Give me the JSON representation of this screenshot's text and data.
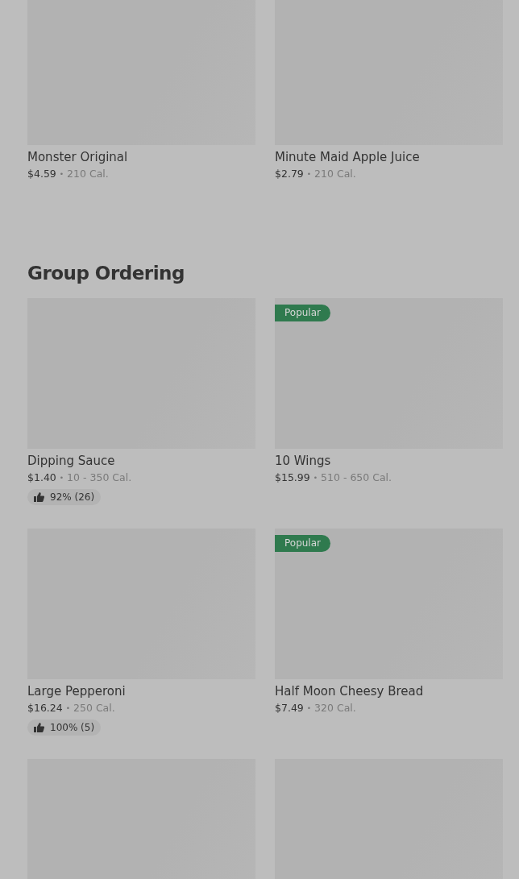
{
  "sections": [
    {
      "items": [
        {
          "kind": "product",
          "name": "Monster Original",
          "price": "$4.59",
          "separator": "•",
          "calories": "210 Cal."
        },
        {
          "kind": "product",
          "name": "Minute Maid Apple Juice",
          "price": "$2.79",
          "separator": "•",
          "calories": "210 Cal."
        }
      ]
    },
    {
      "title": "Group Ordering",
      "items": [
        {
          "kind": "product",
          "name": "Dipping Sauce",
          "price": "$1.40",
          "separator": "•",
          "calories": "10 - 350 Cal.",
          "rating": "92% (26)"
        },
        {
          "kind": "product",
          "name": "10 Wings",
          "price": "$15.99",
          "separator": "•",
          "calories": "510 - 650 Cal.",
          "badge": "Popular"
        },
        {
          "kind": "product",
          "name": "Large Pepperoni",
          "price": "$16.24",
          "separator": "•",
          "calories": "250 Cal.",
          "rating": "100% (5)"
        },
        {
          "kind": "product",
          "name": "Half Moon Cheesy Bread",
          "price": "$7.49",
          "separator": "•",
          "calories": "320 Cal.",
          "badge": "Popular"
        },
        {
          "kind": "image-only"
        },
        {
          "kind": "image-only"
        }
      ]
    }
  ]
}
